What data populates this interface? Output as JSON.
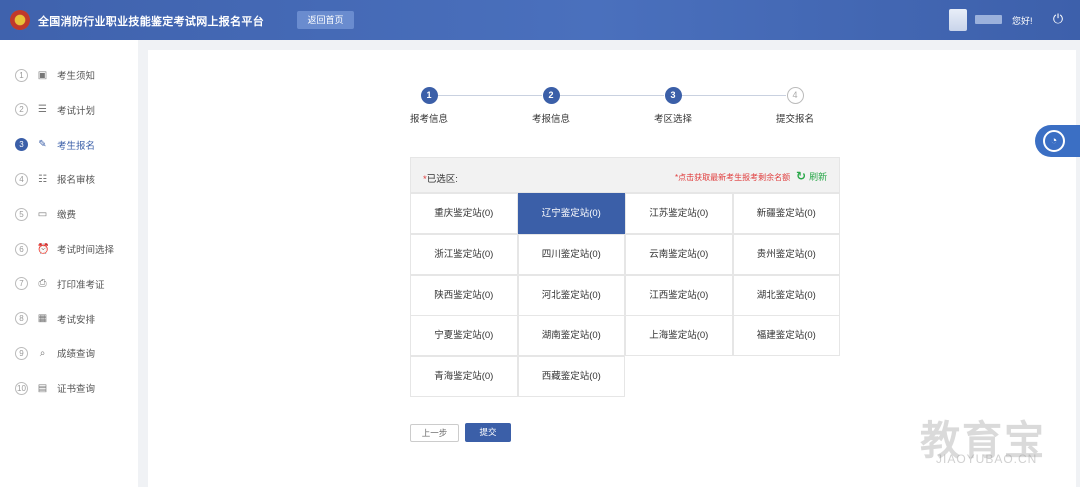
{
  "header": {
    "title": "全国消防行业职业技能鉴定考试网上报名平台",
    "home_button": "返回首页",
    "greeting": "您好!",
    "power_icon": "power-icon"
  },
  "sidebar": {
    "items": [
      {
        "num": "1",
        "label": "考生须知",
        "icon": "notice-icon"
      },
      {
        "num": "2",
        "label": "考试计划",
        "icon": "plan-icon"
      },
      {
        "num": "3",
        "label": "考生报名",
        "icon": "register-icon",
        "active": true
      },
      {
        "num": "4",
        "label": "报名审核",
        "icon": "review-icon"
      },
      {
        "num": "5",
        "label": "缴费",
        "icon": "payment-icon"
      },
      {
        "num": "6",
        "label": "考试时间选择",
        "icon": "clock-icon"
      },
      {
        "num": "7",
        "label": "打印准考证",
        "icon": "printer-icon"
      },
      {
        "num": "8",
        "label": "考试安排",
        "icon": "schedule-icon"
      },
      {
        "num": "9",
        "label": "成绩查询",
        "icon": "search-icon"
      },
      {
        "num": "10",
        "label": "证书查询",
        "icon": "certificate-icon"
      }
    ]
  },
  "steps": [
    {
      "num": "1",
      "label": "报考信息",
      "done": true
    },
    {
      "num": "2",
      "label": "考报信息",
      "done": true
    },
    {
      "num": "3",
      "label": "考区选择",
      "done": true
    },
    {
      "num": "4",
      "label": "提交报名",
      "done": false
    }
  ],
  "selection": {
    "star": "*",
    "label": "已选区:",
    "hint": "*点击获取最新考生报考剩余名额",
    "refresh": "刷新",
    "refresh_icon": "refresh-icon"
  },
  "stations": [
    {
      "name": "重庆鉴定站(0)"
    },
    {
      "name": "辽宁鉴定站(0)",
      "selected": true
    },
    {
      "name": "江苏鉴定站(0)"
    },
    {
      "name": "新疆鉴定站(0)"
    },
    {
      "name": "浙江鉴定站(0)"
    },
    {
      "name": "四川鉴定站(0)"
    },
    {
      "name": "云南鉴定站(0)"
    },
    {
      "name": "贵州鉴定站(0)"
    },
    {
      "name": "陕西鉴定站(0)"
    },
    {
      "name": "河北鉴定站(0)"
    },
    {
      "name": "江西鉴定站(0)"
    },
    {
      "name": "湖北鉴定站(0)"
    },
    {
      "name": "宁夏鉴定站(0)"
    },
    {
      "name": "湖南鉴定站(0)"
    },
    {
      "name": "上海鉴定站(0)"
    },
    {
      "name": "福建鉴定站(0)"
    },
    {
      "name": "青海鉴定站(0)"
    },
    {
      "name": "西藏鉴定站(0)"
    }
  ],
  "buttons": {
    "prev": "上一步",
    "submit": "提交"
  },
  "watermark": {
    "main": "教育宝",
    "sub": "JIAOYUBAO.CN"
  },
  "colors": {
    "primary": "#3b5fa8",
    "hint_red": "#e03c3c",
    "refresh_green": "#2aa84a"
  }
}
